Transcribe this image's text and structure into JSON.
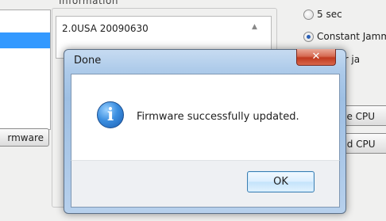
{
  "background": {
    "group_label": "Information",
    "info_text": "2.0USA   20090630",
    "scroll_up_glyph": "▲",
    "firmware_button": "rmware",
    "radios": [
      {
        "label": "5 sec",
        "checked": false
      },
      {
        "label": "Constant Jamm",
        "checked": true
      },
      {
        "label": "e after ja",
        "checked": false
      }
    ],
    "buttons": [
      "ave CPU",
      "ead CPU"
    ]
  },
  "dialog": {
    "title": "Done",
    "close_glyph": "✕",
    "icon": "information-icon",
    "icon_glyph": "i",
    "message": "Firmware successfully updated.",
    "ok_label": "OK"
  },
  "colors": {
    "selection": "#3399ff",
    "dialog_frame": "#aecbea",
    "close_button": "#c0391f",
    "info_icon": "#3c8fe0"
  }
}
